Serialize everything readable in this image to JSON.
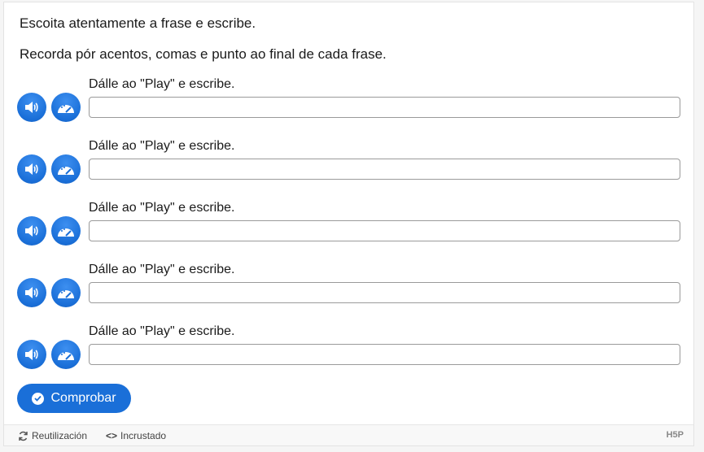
{
  "intro": {
    "line1": "Escoita atentamente a frase e escribe.",
    "line2": "Recorda pór acentos, comas e punto ao final de cada frase."
  },
  "items": [
    {
      "prompt": "Dálle ao \"Play\" e escribe.",
      "value": ""
    },
    {
      "prompt": "Dálle ao \"Play\" e escribe.",
      "value": ""
    },
    {
      "prompt": "Dálle ao \"Play\" e escribe.",
      "value": ""
    },
    {
      "prompt": "Dálle ao \"Play\" e escribe.",
      "value": ""
    },
    {
      "prompt": "Dálle ao \"Play\" e escribe.",
      "value": ""
    }
  ],
  "icons": {
    "play": "speaker-icon",
    "slow": "slow-speed-icon",
    "check": "check-circle-icon"
  },
  "check_button": {
    "label": "Comprobar"
  },
  "footer": {
    "reuse_label": "Reutilización",
    "embed_label": "Incrustado",
    "logo": "H5P"
  },
  "colors": {
    "accent": "#1a6fd8"
  }
}
